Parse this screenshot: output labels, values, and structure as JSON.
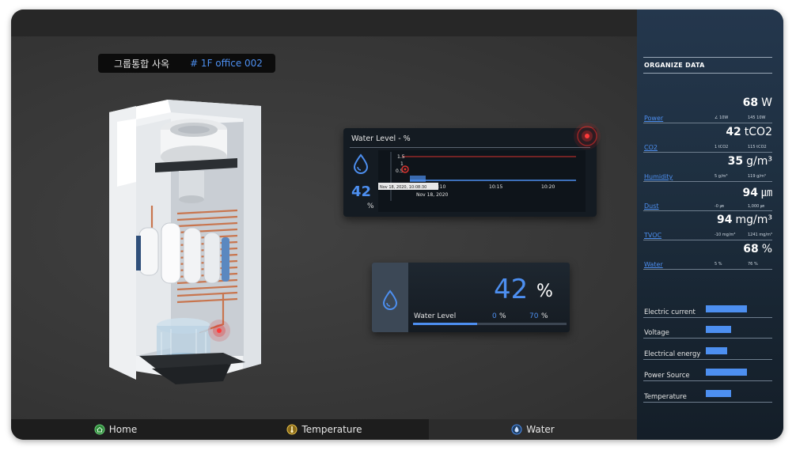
{
  "header": {
    "building_label": "그룹통합 사옥",
    "office_label": "# 1F office 002"
  },
  "chart_panel": {
    "title": "Water Level - %",
    "current_value": "42",
    "unit": "%",
    "chart_data": {
      "type": "line",
      "y_ticks": [
        "1.5",
        "1",
        "0.5"
      ],
      "x_ticks": [
        "10:10",
        "10:15",
        "10:20"
      ],
      "tooltip": "Nov 18, 2020, 10:08:30",
      "date_label": "Nov 18, 2020",
      "threshold_color": "#d8322e",
      "series_color": "#4d8ff0"
    }
  },
  "water_card": {
    "value": "42",
    "unit": "%",
    "label": "Water Level",
    "min_value": "0",
    "min_unit": "%",
    "max_value": "70",
    "max_unit": "%",
    "level": 0.42
  },
  "nav": {
    "home": "Home",
    "temperature": "Temperature",
    "water": "Water",
    "active": "Water"
  },
  "sidebar": {
    "heading": "ORGANIZE DATA",
    "metrics": [
      {
        "label": "Power",
        "value": "68",
        "unit": "W",
        "range_low": "∠ 10W",
        "range_high": "145 10W"
      },
      {
        "label": "CO2",
        "value": "42",
        "unit": "tCO2",
        "range_low": "1 tCO2",
        "range_high": "115 tCO2"
      },
      {
        "label": "Humidity",
        "value": "35",
        "unit": "g/m³",
        "range_low": "5 g/m³",
        "range_high": "119 g/m³"
      },
      {
        "label": "Dust",
        "value": "94",
        "unit": "㎛",
        "range_low": "-0 ㎛",
        "range_high": "1,000 ㎛"
      },
      {
        "label": "TVOC",
        "value": "94",
        "unit": "mg/m³",
        "range_low": "-10 mg/m³",
        "range_high": "1241 mg/m³"
      },
      {
        "label": "Water",
        "value": "68",
        "unit": "%",
        "range_low": "5 %",
        "range_high": "76 %"
      }
    ],
    "bars": [
      {
        "label": "Electric current",
        "level": 0.62
      },
      {
        "label": "Voltage",
        "level": 0.38
      },
      {
        "label": "Electrical energy",
        "level": 0.32
      },
      {
        "label": "Power Source",
        "level": 0.62
      },
      {
        "label": "Temperature",
        "level": 0.38
      }
    ]
  },
  "colors": {
    "accent": "#4d8ff0",
    "alarm": "#e02a2a",
    "background": "#3a3a3a",
    "sidebar": "#1e2f40"
  }
}
